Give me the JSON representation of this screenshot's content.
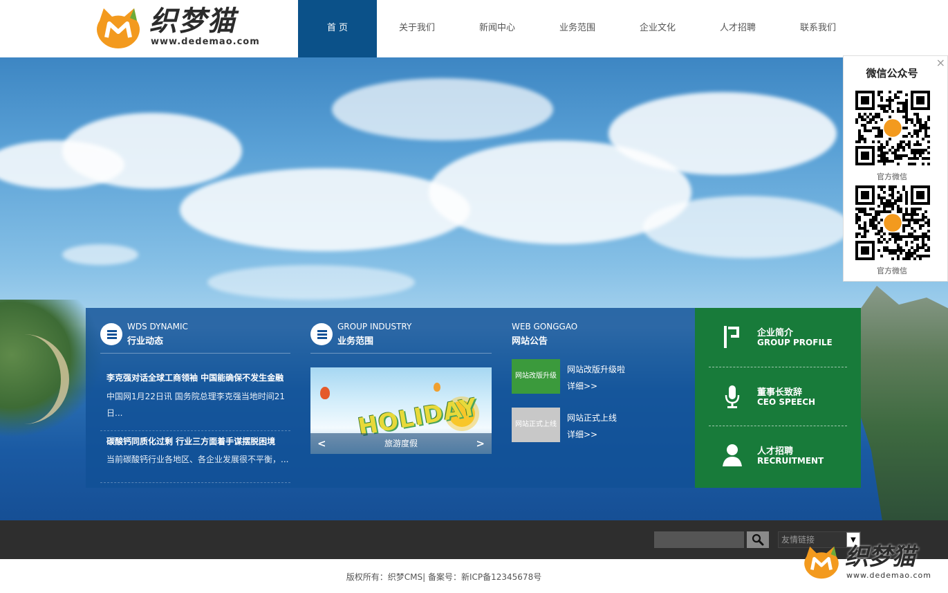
{
  "header": {
    "brand_name": "织梦猫",
    "brand_url": "www.dedemao.com",
    "nav": [
      {
        "label": "首 页",
        "active": true
      },
      {
        "label": "关于我们",
        "active": false
      },
      {
        "label": "新闻中心",
        "active": false
      },
      {
        "label": "业务范围",
        "active": false
      },
      {
        "label": "企业文化",
        "active": false
      },
      {
        "label": "人才招聘",
        "active": false
      },
      {
        "label": "联系我们",
        "active": false
      }
    ]
  },
  "dynamic": {
    "title_en": "WDS DYNAMIC",
    "title_cn": "行业动态",
    "icon": "list-icon",
    "items": [
      {
        "title": "李克强对话全球工商领袖 中国能确保不发生金融",
        "desc": "中国网1月22日讯 国务院总理李克强当地时间21日..."
      },
      {
        "title": "碳酸钙同质化过剩 行业三方面着手谋摆脱困境",
        "desc": "当前碳酸钙行业各地区、各企业发展很不平衡，..."
      }
    ]
  },
  "industry": {
    "title_en": "GROUP INDUSTRY",
    "title_cn": "业务范围",
    "icon": "list-icon",
    "slide_image_text": "HOLIDAY",
    "slide_caption": "旅游度假",
    "prev": "<",
    "next": ">"
  },
  "notice": {
    "title_en": "WEB GONGGAO",
    "title_cn": "网站公告",
    "items": [
      {
        "thumb_text": "网站改版升级",
        "thumb_color": "#3b9a3c",
        "title": "网站改版升级啦",
        "more": "详细>>"
      },
      {
        "thumb_text": "网站正式上线",
        "thumb_color": "#c8c8c8",
        "title": "网站正式上线",
        "more": "详细>>"
      }
    ]
  },
  "side_menu": [
    {
      "cn": "企业简介",
      "en": "GROUP PROFILE",
      "icon": "flag-icon"
    },
    {
      "cn": "董事长致辞",
      "en": "CEO SPEECH",
      "icon": "microphone-icon"
    },
    {
      "cn": "人才招聘",
      "en": "RECRUITMENT",
      "icon": "person-icon"
    }
  ],
  "wechat": {
    "title": "微信公众号",
    "close": "×",
    "qrcodes": [
      {
        "caption": "官方微信"
      },
      {
        "caption": "官方微信"
      }
    ]
  },
  "footer": {
    "search_placeholder": "",
    "select_value": "友情链接",
    "copyright": "版权所有：织梦CMS| 备案号：新ICP备12345678号"
  },
  "colors": {
    "nav_active": "#0b5189",
    "panel_blue": "#115196",
    "menu_green": "#187b3a",
    "logo_orange": "#f39a1e"
  }
}
